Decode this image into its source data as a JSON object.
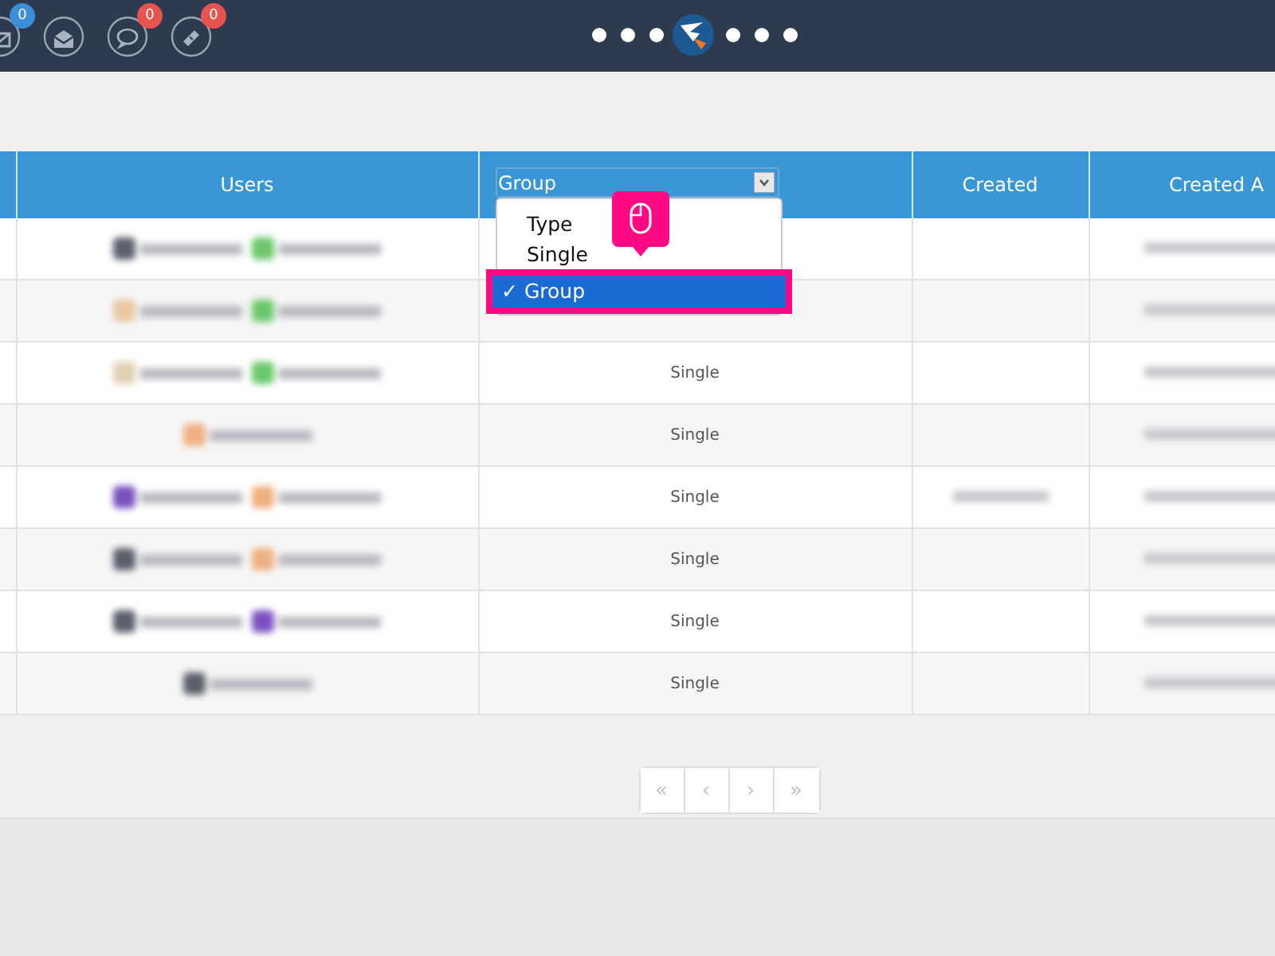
{
  "toolbar": {
    "icons": [
      {
        "kind": "mail",
        "badge": "0",
        "color": "#3a8fd8"
      },
      {
        "kind": "envelope"
      },
      {
        "kind": "chat",
        "badge": "0",
        "color": "#e8534f"
      },
      {
        "kind": "ticket",
        "badge": "0",
        "color": "#e8534f"
      }
    ]
  },
  "table": {
    "columns": [
      {
        "kind": "blank"
      },
      {
        "kind": "text",
        "label": "Users"
      },
      {
        "kind": "select",
        "value": "Group"
      },
      {
        "kind": "text",
        "label": "Created"
      },
      {
        "kind": "text",
        "label": "Created A"
      }
    ],
    "dropdown": {
      "check_mark": "✓",
      "options": [
        {
          "label": "Type",
          "selected": false
        },
        {
          "label": "Single",
          "selected": false
        },
        {
          "label": "Group",
          "selected": true
        }
      ]
    },
    "rows": [
      {
        "users": [
          {
            "color": "#5a5f6b"
          },
          {
            "color": "#6cc86c"
          }
        ],
        "created_blurred": false
      },
      {
        "users": [
          {
            "color": "#e8c8a0"
          },
          {
            "color": "#6cc86c"
          }
        ],
        "created_blurred": false
      },
      {
        "users": [
          {
            "color": "#e0d0b0"
          },
          {
            "color": "#6cc86c"
          }
        ],
        "group": "Single",
        "created_blurred": false
      },
      {
        "users": [
          {
            "color": "#f0b080"
          }
        ],
        "group": "Single",
        "created_blurred": false
      },
      {
        "users": [
          {
            "color": "#7a50c0"
          },
          {
            "color": "#f0b080"
          }
        ],
        "group": "Single",
        "created_blurred": true
      },
      {
        "users": [
          {
            "color": "#5a5f6b"
          },
          {
            "color": "#f0b080"
          }
        ],
        "group": "Single",
        "created_blurred": false
      },
      {
        "users": [
          {
            "color": "#5a5f6b"
          },
          {
            "color": "#7a50c0"
          }
        ],
        "group": "Single",
        "created_blurred": false
      },
      {
        "users": [
          {
            "color": "#5a5f6b"
          }
        ],
        "group": "Single",
        "created_blurred": false
      }
    ]
  },
  "pagination": {
    "buttons": [
      "«",
      "‹",
      "›",
      "»"
    ]
  }
}
